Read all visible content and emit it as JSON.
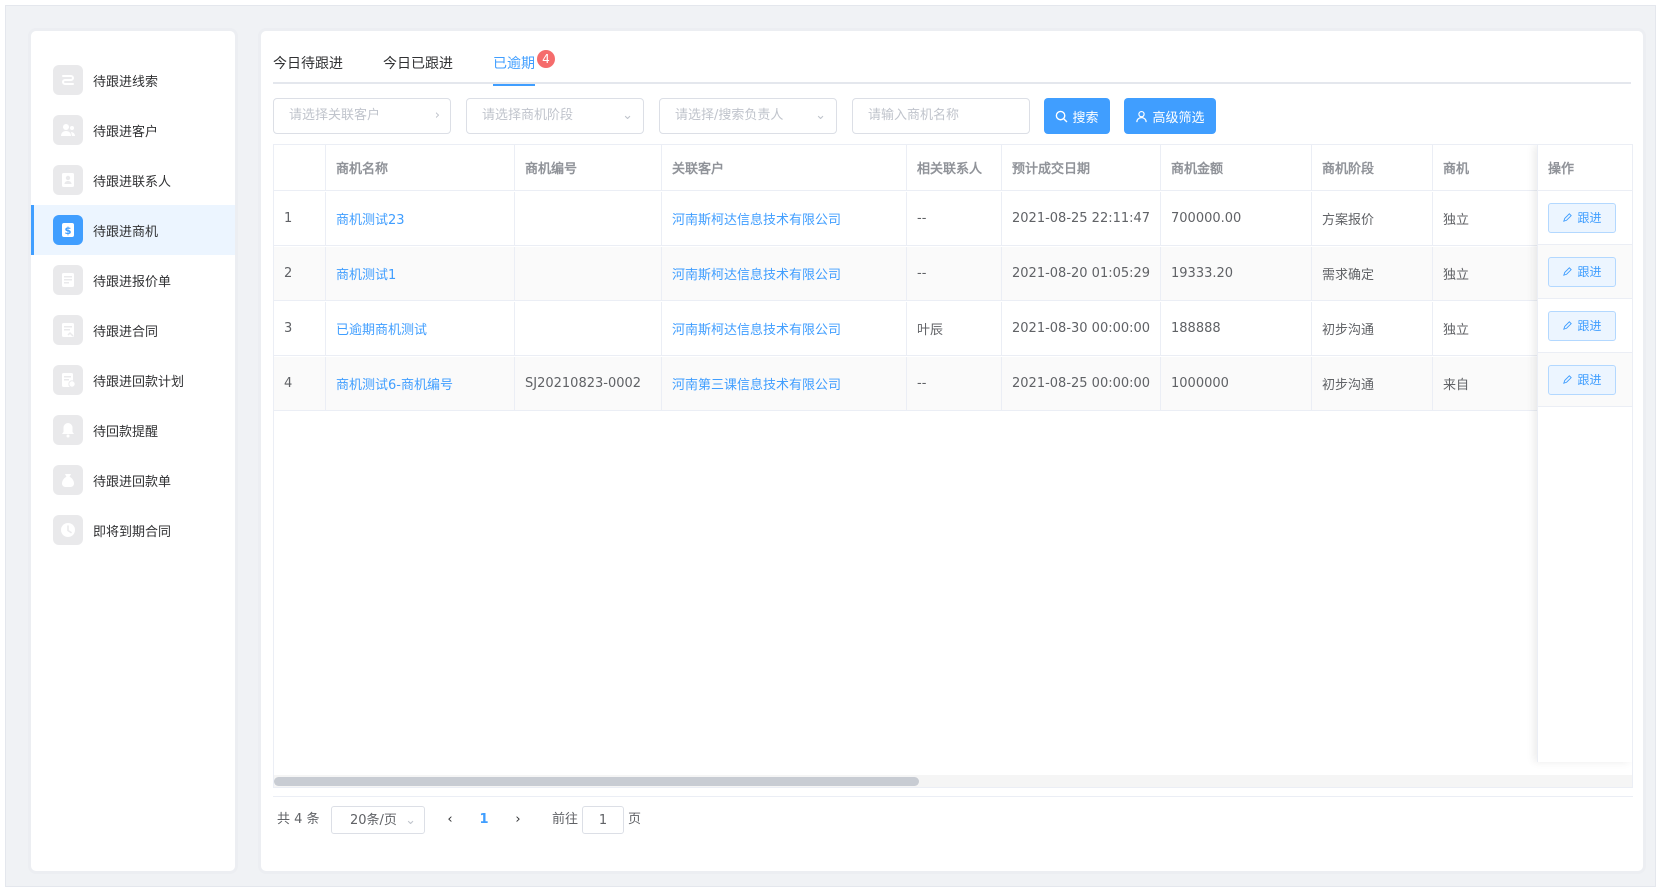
{
  "sidebar": {
    "items": [
      {
        "label": "待跟进线索",
        "icon": "clue-icon"
      },
      {
        "label": "待跟进客户",
        "icon": "customer-icon"
      },
      {
        "label": "待跟进联系人",
        "icon": "contact-icon"
      },
      {
        "label": "待跟进商机",
        "icon": "opportunity-icon",
        "active": true
      },
      {
        "label": "待跟进报价单",
        "icon": "quote-icon"
      },
      {
        "label": "待跟进合同",
        "icon": "contract-icon"
      },
      {
        "label": "待跟进回款计划",
        "icon": "payment-plan-icon"
      },
      {
        "label": "待回款提醒",
        "icon": "bell-icon"
      },
      {
        "label": "待跟进回款单",
        "icon": "money-bag-icon"
      },
      {
        "label": "即将到期合同",
        "icon": "clock-icon"
      }
    ]
  },
  "tabs": [
    {
      "label": "今日待跟进"
    },
    {
      "label": "今日已跟进"
    },
    {
      "label": "已逾期",
      "badge": "4",
      "active": true
    }
  ],
  "filters": {
    "customer_placeholder": "请选择关联客户",
    "stage_placeholder": "请选择商机阶段",
    "owner_placeholder": "请选择/搜索负责人",
    "name_placeholder": "请输入商机名称",
    "search_label": "搜索",
    "advanced_label": "高级筛选"
  },
  "table": {
    "headers": [
      "",
      "商机名称",
      "商机编号",
      "关联客户",
      "相关联系人",
      "预计成交日期",
      "商机金额",
      "商机阶段",
      "商机",
      "操作"
    ],
    "rows": [
      {
        "index": "1",
        "name": "商机测试23",
        "code": "",
        "customer": "河南斯柯达信息技术有限公司",
        "contact": "--",
        "date": "2021-08-25 22:11:47",
        "amount": "700000.00",
        "stage": "方案报价",
        "extra": "独立"
      },
      {
        "index": "2",
        "name": "商机测试1",
        "code": "",
        "customer": "河南斯柯达信息技术有限公司",
        "contact": "--",
        "date": "2021-08-20 01:05:29",
        "amount": "19333.20",
        "stage": "需求确定",
        "extra": "独立"
      },
      {
        "index": "3",
        "name": "已逾期商机测试",
        "code": "",
        "customer": "河南斯柯达信息技术有限公司",
        "contact": "叶辰",
        "date": "2021-08-30 00:00:00",
        "amount": "188888",
        "stage": "初步沟通",
        "extra": "独立"
      },
      {
        "index": "4",
        "name": "商机测试6-商机编号",
        "code": "SJ20210823-0002",
        "customer": "河南第三课信息技术有限公司",
        "contact": "--",
        "date": "2021-08-25 00:00:00",
        "amount": "1000000",
        "stage": "初步沟通",
        "extra": "来自"
      }
    ],
    "action_label": "跟进"
  },
  "pagination": {
    "total": "共 4 条",
    "page_size": "20条/页",
    "prev": "‹",
    "current": "1",
    "next": "›",
    "goto_label": "前往",
    "goto_value": "1",
    "page_suffix": "页"
  },
  "colors": {
    "accent": "#409eff",
    "badge": "#f56c6c"
  }
}
